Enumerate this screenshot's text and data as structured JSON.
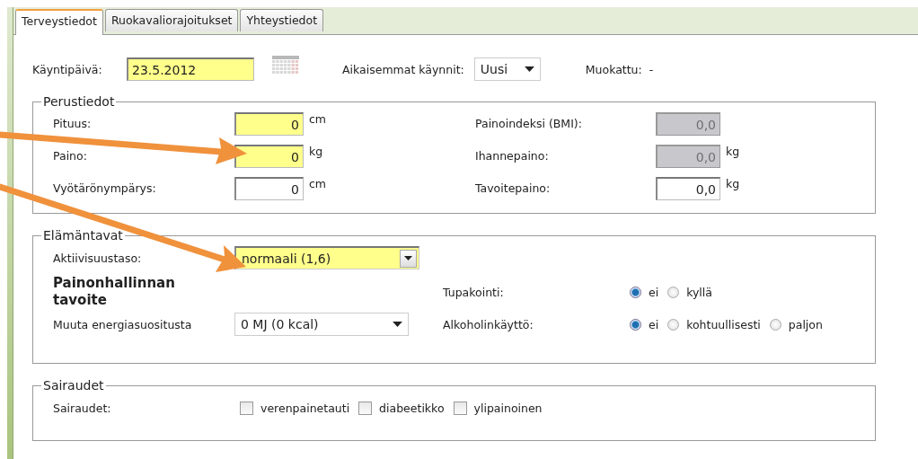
{
  "tabs": [
    {
      "label": "Terveystiedot",
      "selected": true
    },
    {
      "label": "Ruokavaliorajoitukset",
      "selected": false
    },
    {
      "label": "Yhteystiedot",
      "selected": false
    }
  ],
  "visit": {
    "date_label": "Käyntipäivä:",
    "date_value": "23.5.2012",
    "date_highlighted": true,
    "previous_label": "Aikaisemmat käynnit:",
    "previous_value": "Uusi",
    "modified_label": "Muokattu:",
    "modified_value": "-"
  },
  "basic": {
    "legend": "Perustiedot",
    "left_fields": [
      {
        "label": "Pituus:",
        "value": "0",
        "unit": "cm",
        "highlighted": true,
        "disabled": false
      },
      {
        "label": "Paino:",
        "value": "0",
        "unit": "kg",
        "highlighted": true,
        "disabled": false
      },
      {
        "label": "Vyötärönympärys:",
        "value": "0",
        "unit": "cm",
        "highlighted": false,
        "disabled": false
      }
    ],
    "right_fields": [
      {
        "label": "Painoindeksi (BMI):",
        "value": "0,0",
        "highlighted": false,
        "disabled": true
      },
      {
        "label": "Ihannepaino:",
        "value": "0,0",
        "unit": "kg",
        "highlighted": false,
        "disabled": true
      },
      {
        "label": "Tavoitepaino:",
        "value": "0,0",
        "unit": "kg",
        "highlighted": false,
        "disabled": false
      }
    ]
  },
  "lifestyle": {
    "legend": "Elämäntavat",
    "activity": {
      "label": "Aktiivisuustaso:",
      "value": "normaali (1,6)",
      "highlighted": true
    },
    "goal_title": "Painonhallinnan tavoite",
    "energy": {
      "label": "Muuta energiasuositusta",
      "value": "0 MJ (0 kcal)"
    },
    "smoking": {
      "label": "Tupakointi:",
      "options": [
        {
          "label": "ei",
          "selected": true
        },
        {
          "label": "kyllä",
          "selected": false
        }
      ]
    },
    "alcohol": {
      "label": "Alkoholinkäyttö:",
      "options": [
        {
          "label": "ei",
          "selected": true
        },
        {
          "label": "kohtuullisesti",
          "selected": false
        },
        {
          "label": "paljon",
          "selected": false
        }
      ]
    }
  },
  "diseases": {
    "legend": "Sairaudet",
    "label": "Sairaudet:",
    "options": [
      {
        "label": "verenpainetauti",
        "checked": false
      },
      {
        "label": "diabeetikko",
        "checked": false
      },
      {
        "label": "ylipainoinen",
        "checked": false
      }
    ]
  }
}
